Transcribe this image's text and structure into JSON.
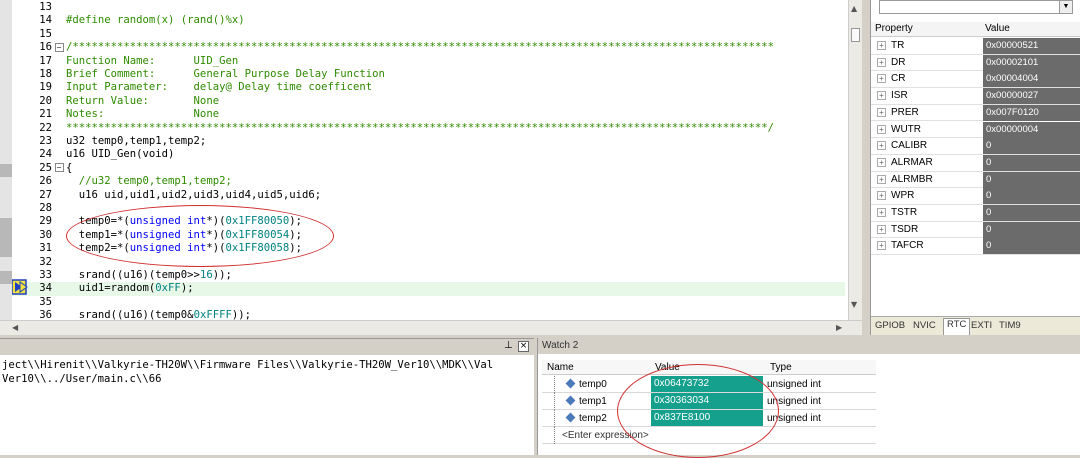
{
  "editor": {
    "lines": [
      {
        "n": "13",
        "segs": []
      },
      {
        "n": "14",
        "segs": [
          {
            "t": "#define random(x) (rand()%x)",
            "c": "cm"
          }
        ]
      },
      {
        "n": "15",
        "segs": []
      },
      {
        "n": "16",
        "fold": "-",
        "segs": [
          {
            "t": "/**************************************************************************************************************",
            "c": "cm"
          }
        ]
      },
      {
        "n": "17",
        "segs": [
          {
            "t": "Function Name:      UID_Gen",
            "c": "cm"
          }
        ]
      },
      {
        "n": "18",
        "segs": [
          {
            "t": "Brief Comment:      General Purpose Delay Function",
            "c": "cm"
          }
        ]
      },
      {
        "n": "19",
        "segs": [
          {
            "t": "Input Parameter:    delay@ Delay time coefficent",
            "c": "cm"
          }
        ]
      },
      {
        "n": "20",
        "segs": [
          {
            "t": "Return Value:       None",
            "c": "cm"
          }
        ]
      },
      {
        "n": "21",
        "segs": [
          {
            "t": "Notes:              None",
            "c": "cm"
          }
        ]
      },
      {
        "n": "22",
        "segs": [
          {
            "t": "**************************************************************************************************************/",
            "c": "cm"
          }
        ]
      },
      {
        "n": "23",
        "segs": [
          {
            "t": "u32 temp0,temp1,temp2;"
          }
        ]
      },
      {
        "n": "24",
        "segs": [
          {
            "t": "u16 UID_Gen(void)"
          }
        ]
      },
      {
        "n": "25",
        "fold": "-",
        "segs": [
          {
            "t": "{"
          }
        ]
      },
      {
        "n": "26",
        "segs": [
          {
            "t": "  "
          },
          {
            "t": "//u32 temp0,temp1,temp2;",
            "c": "cm"
          }
        ]
      },
      {
        "n": "27",
        "segs": [
          {
            "t": "  u16 uid,uid1,uid2,uid3,uid4,uid5,uid6;"
          }
        ]
      },
      {
        "n": "28",
        "segs": []
      },
      {
        "n": "29",
        "segs": [
          {
            "t": "  temp0=*("
          },
          {
            "t": "unsigned int",
            "c": "kw"
          },
          {
            "t": "*)("
          },
          {
            "t": "0x1FF80050",
            "c": "num"
          },
          {
            "t": ");"
          }
        ]
      },
      {
        "n": "30",
        "segs": [
          {
            "t": "  temp1=*("
          },
          {
            "t": "unsigned int",
            "c": "kw"
          },
          {
            "t": "*)("
          },
          {
            "t": "0x1FF80054",
            "c": "num"
          },
          {
            "t": ");"
          }
        ]
      },
      {
        "n": "31",
        "segs": [
          {
            "t": "  temp2=*("
          },
          {
            "t": "unsigned int",
            "c": "kw"
          },
          {
            "t": "*)("
          },
          {
            "t": "0x1FF80058",
            "c": "num"
          },
          {
            "t": ");"
          }
        ]
      },
      {
        "n": "32",
        "segs": []
      },
      {
        "n": "33",
        "segs": [
          {
            "t": "  srand((u16)(temp0>>"
          },
          {
            "t": "16",
            "c": "num"
          },
          {
            "t": "));"
          }
        ]
      },
      {
        "n": "34",
        "cur": true,
        "segs": [
          {
            "t": "  uid1=random("
          },
          {
            "t": "0xFF",
            "c": "num"
          },
          {
            "t": ");"
          }
        ]
      },
      {
        "n": "35",
        "segs": []
      },
      {
        "n": "36",
        "segs": [
          {
            "t": "  srand((u16)(temp0&"
          },
          {
            "t": "0xFFFF",
            "c": "num"
          },
          {
            "t": "));"
          }
        ]
      }
    ]
  },
  "properties": {
    "header": {
      "property": "Property",
      "value": "Value"
    },
    "rows": [
      {
        "name": "TR",
        "value": "0x00000521"
      },
      {
        "name": "DR",
        "value": "0x00002101"
      },
      {
        "name": "CR",
        "value": "0x00004004"
      },
      {
        "name": "ISR",
        "value": "0x00000027"
      },
      {
        "name": "PRER",
        "value": "0x007F0120"
      },
      {
        "name": "WUTR",
        "value": "0x00000004"
      },
      {
        "name": "CALIBR",
        "value": "0"
      },
      {
        "name": "ALRMAR",
        "value": "0"
      },
      {
        "name": "ALRMBR",
        "value": "0"
      },
      {
        "name": "WPR",
        "value": "0"
      },
      {
        "name": "TSTR",
        "value": "0"
      },
      {
        "name": "TSDR",
        "value": "0"
      },
      {
        "name": "TAFCR",
        "value": "0"
      }
    ],
    "tabs": [
      "GPIOB",
      "NVIC",
      "RTC",
      "EXTI",
      "TIM9"
    ],
    "active_tab": "RTC"
  },
  "output": {
    "line1": "ject\\\\Hirenit\\\\Valkyrie-TH20W\\\\Firmware Files\\\\Valkyrie-TH20W_Ver10\\\\MDK\\\\Val",
    "line2": "Ver10\\\\../User/main.c\\\\66"
  },
  "watch": {
    "title": "Watch 2",
    "header": {
      "name": "Name",
      "value": "Value",
      "type": "Type"
    },
    "rows": [
      {
        "name": "temp0",
        "value": "0x06473732",
        "type": "unsigned int"
      },
      {
        "name": "temp1",
        "value": "0x30363034",
        "type": "unsigned int"
      },
      {
        "name": "temp2",
        "value": "0x837E8100",
        "type": "unsigned int"
      }
    ],
    "enter_expression": "<Enter expression>"
  }
}
